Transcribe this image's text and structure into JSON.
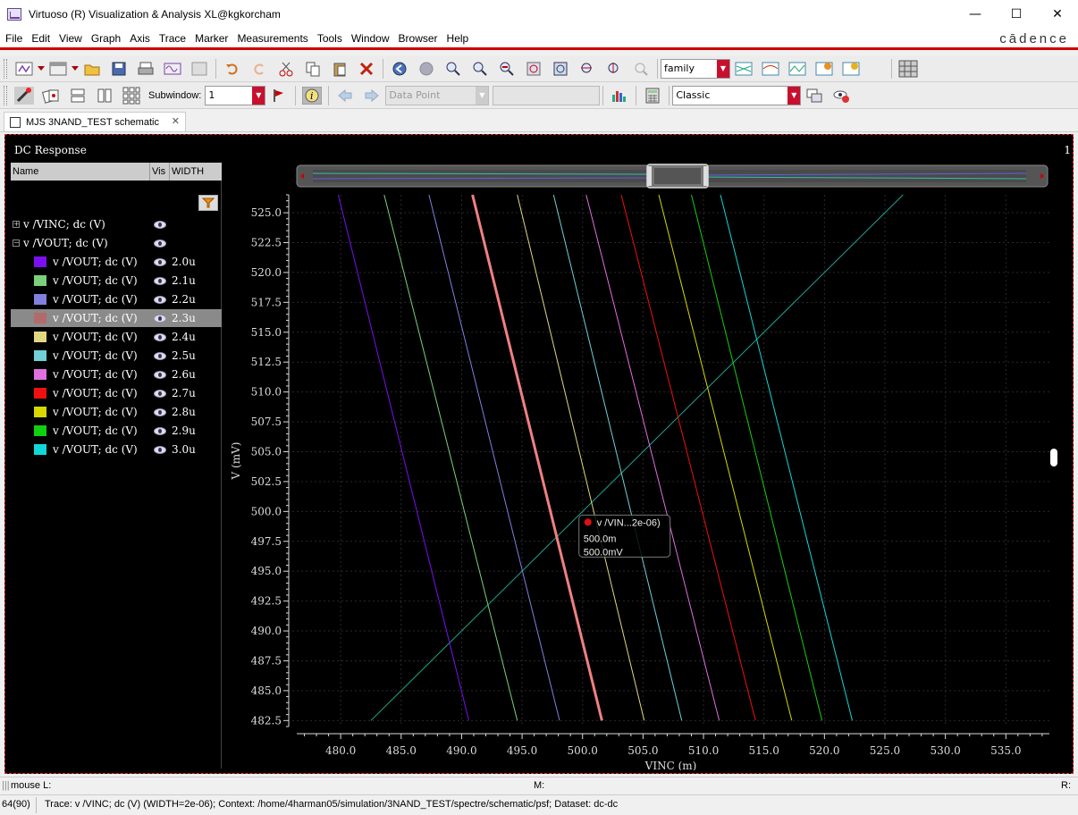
{
  "window": {
    "title": "Virtuoso (R) Visualization & Analysis XL@kgkorcham"
  },
  "menu": {
    "items": [
      "File",
      "Edit",
      "View",
      "Graph",
      "Axis",
      "Trace",
      "Marker",
      "Measurements",
      "Tools",
      "Window",
      "Browser",
      "Help"
    ],
    "brand": "cādence"
  },
  "toolbar": {
    "plot_mode": "family",
    "subwindow_label": "Subwindow:",
    "subwindow_value": "1",
    "marker_type": "Data Point",
    "marker_value": "",
    "style": "Classic"
  },
  "tab": {
    "label": "MJS 3NAND_TEST schematic"
  },
  "panel": {
    "title": "DC Response",
    "subwindow_number": "1",
    "columns": [
      "Name",
      "Vis",
      "WIDTH"
    ],
    "parents": [
      {
        "label": "v /VINC; dc (V)",
        "expander": "+"
      },
      {
        "label": "v /VOUT; dc (V)",
        "expander": "−"
      }
    ],
    "traces": [
      {
        "label": "v /VOUT; dc (V)",
        "width": "2.0u",
        "color": "#7a10f0"
      },
      {
        "label": "v /VOUT; dc (V)",
        "width": "2.1u",
        "color": "#7ad17a"
      },
      {
        "label": "v /VOUT; dc (V)",
        "width": "2.2u",
        "color": "#8080e0"
      },
      {
        "label": "v /VOUT; dc (V)",
        "width": "2.3u",
        "color": "#b36a6a",
        "selected": true
      },
      {
        "label": "v /VOUT; dc (V)",
        "width": "2.4u",
        "color": "#e0d880"
      },
      {
        "label": "v /VOUT; dc (V)",
        "width": "2.5u",
        "color": "#70d0d8"
      },
      {
        "label": "v /VOUT; dc (V)",
        "width": "2.6u",
        "color": "#e070e0"
      },
      {
        "label": "v /VOUT; dc (V)",
        "width": "2.7u",
        "color": "#f01010"
      },
      {
        "label": "v /VOUT; dc (V)",
        "width": "2.8u",
        "color": "#d8d800"
      },
      {
        "label": "v /VOUT; dc (V)",
        "width": "2.9u",
        "color": "#10d010"
      },
      {
        "label": "v /VOUT; dc (V)",
        "width": "3.0u",
        "color": "#10d8d8"
      }
    ]
  },
  "chart_data": {
    "type": "line",
    "xlabel": "VINC (m)",
    "ylabel": "V (mV)",
    "xlim": [
      476.0,
      538.6
    ],
    "ylim": [
      482.0,
      526.5
    ],
    "xticks": [
      "480.0",
      "485.0",
      "490.0",
      "495.0",
      "500.0",
      "505.0",
      "510.0",
      "515.0",
      "520.0",
      "525.0",
      "530.0",
      "535.0"
    ],
    "yticks": [
      "525.0",
      "522.5",
      "520.0",
      "517.5",
      "515.0",
      "512.5",
      "510.0",
      "507.5",
      "505.0",
      "502.5",
      "500.0",
      "497.5",
      "495.0",
      "492.5",
      "490.0",
      "487.5",
      "485.0",
      "482.5"
    ],
    "grid": true,
    "series": [
      {
        "name": "v /VINC; dc (V)",
        "color": "#1aa890",
        "points": [
          [
            482.5,
            482.5
          ],
          [
            526.5,
            526.5
          ]
        ]
      },
      {
        "name": "2.0u",
        "color": "#7a10f0",
        "points": [
          [
            479.8,
            526.5
          ],
          [
            490.6,
            482.5
          ]
        ]
      },
      {
        "name": "2.1u",
        "color": "#7ad17a",
        "points": [
          [
            483.6,
            526.5
          ],
          [
            494.6,
            482.5
          ]
        ]
      },
      {
        "name": "2.2u",
        "color": "#8080e0",
        "points": [
          [
            487.3,
            526.5
          ],
          [
            498.1,
            482.5
          ]
        ]
      },
      {
        "name": "2.3u",
        "color": "#f08080",
        "points": [
          [
            490.9,
            526.5
          ],
          [
            501.6,
            482.5
          ]
        ]
      },
      {
        "name": "2.4u",
        "color": "#e0d880",
        "points": [
          [
            494.6,
            526.5
          ],
          [
            505.1,
            482.5
          ]
        ]
      },
      {
        "name": "2.5u",
        "color": "#70d0d8",
        "points": [
          [
            497.6,
            526.5
          ],
          [
            508.2,
            482.5
          ]
        ]
      },
      {
        "name": "2.6u",
        "color": "#e070e0",
        "points": [
          [
            500.3,
            526.5
          ],
          [
            511.3,
            482.5
          ]
        ]
      },
      {
        "name": "2.7u",
        "color": "#f01010",
        "points": [
          [
            503.2,
            526.5
          ],
          [
            514.3,
            482.5
          ]
        ]
      },
      {
        "name": "2.8u",
        "color": "#d8d800",
        "points": [
          [
            506.3,
            526.5
          ],
          [
            517.3,
            482.5
          ]
        ]
      },
      {
        "name": "2.9u",
        "color": "#10d010",
        "points": [
          [
            509.0,
            526.5
          ],
          [
            519.8,
            482.5
          ]
        ]
      },
      {
        "name": "3.0u",
        "color": "#10d8d8",
        "points": [
          [
            511.4,
            526.5
          ],
          [
            522.3,
            482.5
          ]
        ]
      }
    ],
    "selected_series": "2.3u",
    "marker": {
      "title": "v /VIN...2e-06)",
      "x_value": "500.0m",
      "y_value": "500.0mV",
      "x": 500.0,
      "y": 500.0
    }
  },
  "status": {
    "mouse_l": "mouse L:",
    "mouse_m": "M:",
    "mouse_r": "R:",
    "count": "64(90)",
    "message": "Trace: v /VINC; dc (V) (WIDTH=2e-06); Context: /home/4harman05/simulation/3NAND_TEST/spectre/schematic/psf; Dataset: dc-dc"
  }
}
